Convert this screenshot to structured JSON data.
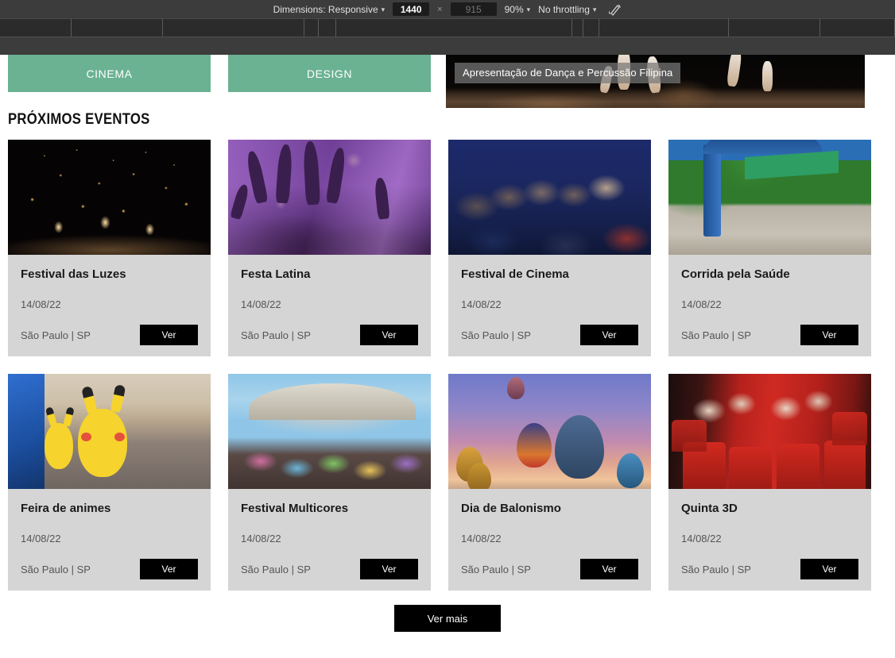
{
  "devtools": {
    "dimensions_label": "Dimensions: Responsive",
    "width_value": "1440",
    "height_placeholder": "915",
    "zoom_label": "90%",
    "throttling_label": "No throttling",
    "rotate_icon": "rotate-device-icon",
    "caret": "▾"
  },
  "categories": [
    {
      "label": "CINEMA",
      "name": "cinema"
    },
    {
      "label": "DESIGN",
      "name": "design"
    }
  ],
  "banner": {
    "caption": "Apresentação de Dança e Percussão Filipina"
  },
  "section": {
    "title": "PRÓXIMOS EVENTOS"
  },
  "events": [
    {
      "title": "Festival das Luzes",
      "date": "14/08/22",
      "place": "São Paulo | SP",
      "button": "Ver",
      "image": "lanterns-photo"
    },
    {
      "title": "Festa Latina",
      "date": "14/08/22",
      "place": "São Paulo | SP",
      "button": "Ver",
      "image": "concert-hands-photo"
    },
    {
      "title": "Festival de Cinema",
      "date": "14/08/22",
      "place": "São Paulo | SP",
      "button": "Ver",
      "image": "cinema-audience-photo"
    },
    {
      "title": "Corrida pela Saúde",
      "date": "14/08/22",
      "place": "São Paulo | SP",
      "button": "Ver",
      "image": "race-arch-photo"
    },
    {
      "title": "Feira de animes",
      "date": "14/08/22",
      "place": "São Paulo | SP",
      "button": "Ver",
      "image": "pikachu-fair-photo"
    },
    {
      "title": "Festival Multicores",
      "date": "14/08/22",
      "place": "São Paulo | SP",
      "button": "Ver",
      "image": "color-festival-photo"
    },
    {
      "title": "Dia de Balonismo",
      "date": "14/08/22",
      "place": "São Paulo | SP",
      "button": "Ver",
      "image": "hot-air-balloons-photo"
    },
    {
      "title": "Quinta 3D",
      "date": "14/08/22",
      "place": "São Paulo | SP",
      "button": "Ver",
      "image": "3d-cinema-photo"
    }
  ],
  "footer": {
    "more_label": "Ver mais"
  },
  "colors": {
    "category_green": "#6ab292",
    "card_background": "#d5d5d5",
    "button_black": "#000000",
    "devtools_bar": "#3c3c3c"
  }
}
